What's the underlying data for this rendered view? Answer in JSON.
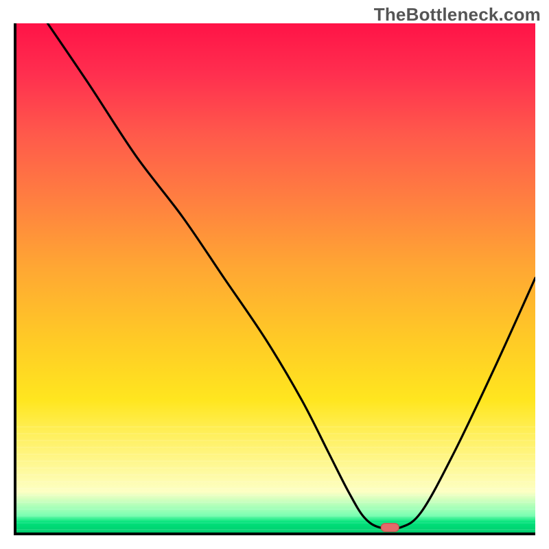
{
  "watermark": "TheBottleneck.com",
  "colors": {
    "axis": "#000000",
    "curve": "#000000",
    "marker": "#e46a6a",
    "gradient_top": "#ff1347",
    "gradient_mid": "#ffca26",
    "gradient_bottom": "#00cc6e"
  },
  "chart_data": {
    "type": "line",
    "title": "",
    "xlabel": "",
    "ylabel": "",
    "xlim": [
      0,
      100
    ],
    "ylim": [
      0,
      100
    ],
    "grid": false,
    "legend": false,
    "series": [
      {
        "name": "bottleneck-curve",
        "x": [
          6,
          14,
          23,
          32,
          40,
          48,
          55,
          60,
          64,
          67,
          70,
          74,
          78,
          84,
          92,
          100
        ],
        "values": [
          100,
          88,
          74,
          62,
          50,
          38,
          26,
          16,
          8,
          3,
          1,
          1,
          4,
          15,
          32,
          50
        ]
      }
    ],
    "annotations": [
      {
        "name": "optimal-marker",
        "x": 72,
        "y": 1
      }
    ],
    "background": "vertical-gradient red→yellow→green"
  }
}
